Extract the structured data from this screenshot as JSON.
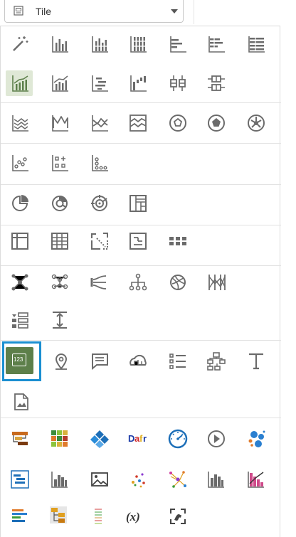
{
  "dropdown": {
    "selected": "Tile",
    "icon": "tile-icon"
  },
  "colors": {
    "icon_gray": "#6b6b6b",
    "selected_ring": "#1a8fd1",
    "tile_green": "#5d7f4a",
    "highlight_bg": "#dfe8d6",
    "divider": "#e2e2e2"
  },
  "tile_number": "123",
  "formula_label": "(x)",
  "rows": [
    {
      "section": 1,
      "icons": [
        "magic-wand-icon",
        "vertical-bar-icon",
        "stacked-bar-icon",
        "stacked-bar-100-icon",
        "horizontal-bar-icon",
        "horizontal-stacked-bar-icon",
        "horizontal-stacked-bar-100-icon"
      ]
    },
    {
      "section": 1,
      "icons": [
        "combo-chart-icon",
        "combo-line-bar-icon",
        "horizontal-range-icon",
        "waterfall-icon",
        "boxplot-icon",
        "horizontal-boxplot-icon"
      ]
    },
    {
      "section": 2,
      "icons": [
        "line-chart-icon",
        "radar-line-icon",
        "area-icon",
        "stacked-area-icon",
        "donut-ring-icon",
        "donut-filled-icon",
        "sunburst-icon"
      ]
    },
    {
      "section": 3,
      "icons": [
        "scatter-icon",
        "grid-scatter-icon",
        "dot-plot-icon"
      ]
    },
    {
      "section": 4,
      "icons": [
        "pie-icon",
        "donut-chart-icon",
        "radial-icon",
        "treemap-icon"
      ]
    },
    {
      "section": 5,
      "icons": [
        "table-icon",
        "pivot-table-icon",
        "correlation-matrix-icon",
        "filter-table-icon",
        "tile-grid-icon"
      ]
    },
    {
      "section": 6,
      "icons": [
        "network-icon",
        "cluster-network-icon",
        "sankey-icon",
        "hierarchy-icon",
        "chord-icon",
        "parallel-coordinates-icon"
      ]
    },
    {
      "section": 7,
      "icons": [
        "list-filter-icon",
        "spacer-icon"
      ]
    },
    {
      "section": 8,
      "icons": [
        "metric-tile-icon",
        "map-pin-icon",
        "text-box-icon",
        "cloud-map-icon",
        "list-icon",
        "tree-org-icon",
        "text-icon"
      ]
    },
    {
      "section": 8,
      "icons": [
        "image-icon"
      ]
    },
    {
      "section": 9,
      "icons": [
        "plugin-flow-icon",
        "plugin-heatmap-icon",
        "plugin-diamond-icon",
        "plugin-logo-icon",
        "plugin-gauge-icon",
        "plugin-play-icon",
        "plugin-bubbles-icon"
      ]
    },
    {
      "section": 9,
      "icons": [
        "plugin-gantt-icon",
        "plugin-bar-icon",
        "plugin-image-icon",
        "plugin-scatter-icon",
        "plugin-network-icon",
        "plugin-histogram-icon",
        "plugin-pareto-icon"
      ]
    },
    {
      "section": 9,
      "icons": [
        "plugin-timeline-icon",
        "plugin-tree-icon",
        "plugin-legend-icon",
        "formula-icon",
        "focus-capture-icon"
      ]
    }
  ]
}
